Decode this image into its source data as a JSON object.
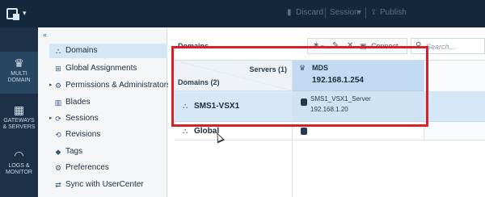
{
  "topbar": {
    "discard_label": "Discard",
    "session_label": "Session",
    "publish_label": "Publish"
  },
  "leftnav": {
    "items": [
      {
        "label_line1": "MULTI",
        "label_line2": "DOMAIN",
        "icon": "crown-icon"
      },
      {
        "label_line1": "GATEWAYS",
        "label_line2": "& SERVERS",
        "icon": "gateways-icon"
      },
      {
        "label_line1": "LOGS &",
        "label_line2": "MONITOR",
        "icon": "gauge-icon"
      }
    ]
  },
  "subpanel": {
    "collapse": "«",
    "items": [
      {
        "label": "Domains",
        "icon": "domains-icon"
      },
      {
        "label": "Global Assignments",
        "icon": "global-assignments-icon"
      },
      {
        "label": "Permissions & Administrators",
        "icon": "permissions-icon"
      },
      {
        "label": "Blades",
        "icon": "blades-icon"
      },
      {
        "label": "Sessions",
        "icon": "sessions-icon"
      },
      {
        "label": "Revisions",
        "icon": "revisions-icon"
      },
      {
        "label": "Tags",
        "icon": "tag-icon"
      },
      {
        "label": "Preferences",
        "icon": "preferences-icon"
      },
      {
        "label": "Sync with UserCenter",
        "icon": "sync-icon"
      }
    ]
  },
  "main": {
    "title": "Domains",
    "toolbar": {
      "connect_label": "Connect"
    },
    "search": {
      "placeholder": "Search..."
    },
    "grid": {
      "servers_header": "Servers (1)",
      "domains_header": "Domains (2)",
      "server": {
        "name": "MDS",
        "ip": "192.168.1.254"
      },
      "rows": [
        {
          "domain": "SMS1-VSX1",
          "server_name": "SMS1_VSX1_Server",
          "server_ip": "192.168.1.20"
        },
        {
          "domain": "Global"
        }
      ]
    }
  },
  "colors": {
    "topbar": "#14283d",
    "leftnav": "#1c3148",
    "selection": "#d6e8f8",
    "highlight": "#d8202a"
  }
}
